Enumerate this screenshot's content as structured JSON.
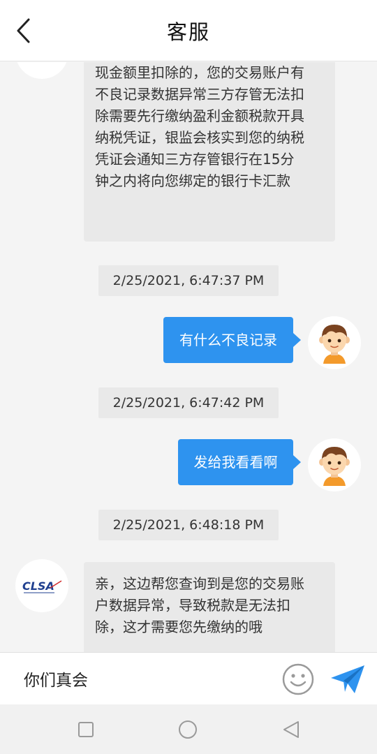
{
  "header": {
    "title": "客服"
  },
  "messages": {
    "agent_prev_lines": [
      "现金额里扣除的，您的交易账户有",
      "不良记录数据异常三方存管无法扣",
      "除需要先行缴纳盈利金额税款开具",
      "纳税凭证，银监会核实到您的纳税",
      "凭证会通知三方存管银行在15分",
      "钟之内将向您绑定的银行卡汇款"
    ],
    "ts1": "2/25/2021, 6:47:37 PM",
    "user_msg1": "有什么不良记录",
    "ts2": "2/25/2021, 6:47:42 PM",
    "user_msg2": "发给我看看啊",
    "ts3": "2/25/2021, 6:48:18 PM",
    "agent_reply_lines": [
      "亲，这边帮您查询到是您的交易账",
      "户数据异常，导致税款是无法扣",
      "除，这才需要您先缴纳的哦"
    ],
    "agent_logo_text": "CLSA"
  },
  "input": {
    "value": "你们真会"
  },
  "icons": {
    "back": "chevron-left-icon",
    "emoji": "smiley-icon",
    "send": "paper-plane-icon",
    "nav_recents": "square-icon",
    "nav_home": "circle-icon",
    "nav_back": "triangle-back-icon"
  },
  "colors": {
    "accent": "#2e93ef",
    "bubble_in": "#e9e9e9",
    "background": "#f4f4f4"
  }
}
